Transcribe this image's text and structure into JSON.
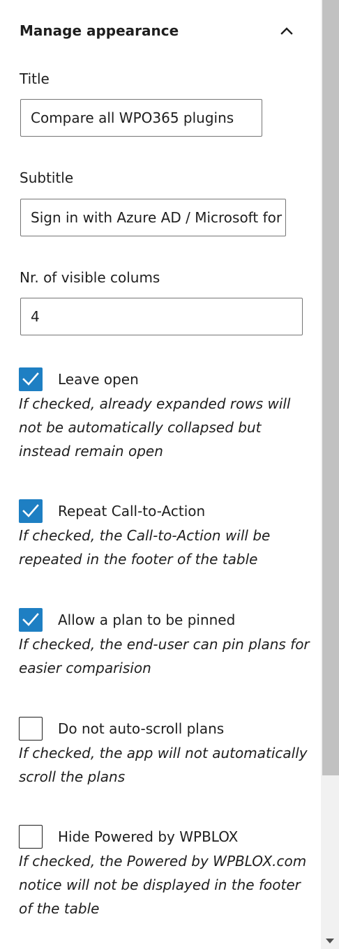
{
  "panel": {
    "title": "Manage appearance",
    "collapse_icon": "chevron-up-icon"
  },
  "fields": {
    "title": {
      "label": "Title",
      "value": "Compare all WPO365 plugins"
    },
    "subtitle": {
      "label": "Subtitle",
      "value": "Sign in with Azure AD / Microsoft for WordPress"
    },
    "visible_columns": {
      "label": "Nr. of visible colums",
      "value": "4"
    }
  },
  "options": [
    {
      "label": "Leave open",
      "checked": true,
      "help": "If checked, already expanded rows will not be automatically collapsed but instead remain open"
    },
    {
      "label": "Repeat Call-to-Action",
      "checked": true,
      "help": "If checked, the Call-to-Action will be repeated in the footer of the table"
    },
    {
      "label": "Allow a plan to be pinned",
      "checked": true,
      "help": "If checked, the end-user can pin plans for easier comparision"
    },
    {
      "label": "Do not auto-scroll plans",
      "checked": false,
      "help": "If checked, the app will not automatically scroll the plans"
    },
    {
      "label": "Hide Powered by WPBLOX",
      "checked": false,
      "help": "If checked, the Powered by WPBLOX.com notice will not be displayed in the footer of the table"
    }
  ],
  "colors": {
    "checkbox_accent": "#1e7fc3",
    "text": "#1e1e1e",
    "input_border": "#757575",
    "scrollbar_thumb": "#c1c1c1",
    "scrollbar_track": "#f1f1f1"
  }
}
